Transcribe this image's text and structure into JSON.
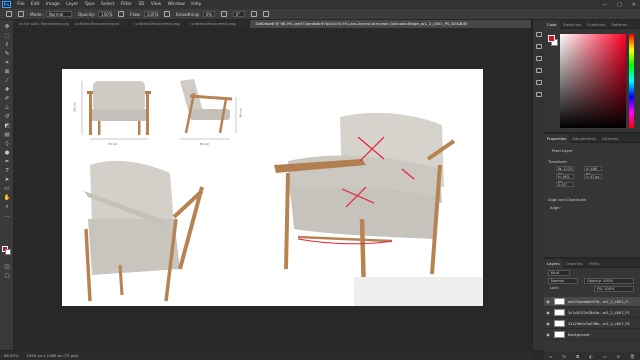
{
  "app": {
    "logo": "Ps",
    "window_controls": [
      "—",
      "□",
      "✕"
    ]
  },
  "menu": [
    "File",
    "Edit",
    "Image",
    "Layer",
    "Type",
    "Select",
    "Filter",
    "3D",
    "View",
    "Window",
    "Help"
  ],
  "options": {
    "mode_label": "Mode:",
    "mode_value": "Normal",
    "opacity_label": "Opacity:",
    "opacity_value": "100%",
    "flow_label": "Flow:",
    "flow_value": "100%",
    "smoothing_label": "Smoothing:",
    "smoothing_value": "0%",
    "angle_value": "0°"
  },
  "tabs": [
    {
      "label": "cs for sofa, Recovered.png"
    },
    {
      "label": "untitled-Recovered.psd"
    },
    {
      "label": "untitled-Recovered.png"
    },
    {
      "label": "untitled-Recovered.png"
    },
    {
      "label": "1b60dbe8 @ 66.9% (ae374aeab8c97b0e2c5c79-Lars-Accent-Armchair-Oakcolor-Beige_ar1_2_LB01_PS_BG&B/8)"
    }
  ],
  "status": {
    "zoom": "66.92%",
    "doc_size": "1920 px x 1080 px (72 ppi)"
  },
  "document": {
    "dims": {
      "front_width": "70 cm",
      "side_depth": "80 cm",
      "front_height": "68 cm",
      "side_height": "68 cm"
    }
  },
  "colors": {
    "foreground": "#c8102e",
    "background": "#ffffff",
    "annotation": "#e8203a"
  },
  "color_panel": {
    "tabs": [
      "Color",
      "Swatches",
      "Gradients",
      "Patterns"
    ]
  },
  "properties": {
    "tabs": [
      "Properties",
      "Adjustments",
      "Libraries"
    ],
    "layer_type": "Pixel Layer",
    "transform_title": "Transform",
    "w": "W: 1235 px",
    "h": "H: 695 px",
    "x": "X: 486 px",
    "y": "Y: 47 px",
    "angle": "0.00°",
    "align_title": "Align and Distribute",
    "align_label": "Align:"
  },
  "layers": {
    "tabs": [
      "Layers",
      "Channels",
      "Paths"
    ],
    "kind": "Kind",
    "blend": "Normal",
    "opacity": "Opacity: 100%",
    "lock": "Lock:",
    "fill": "Fill: 100%",
    "items": [
      {
        "name": "ae374aeab8c97b...ar1_2_LB01_P...",
        "visible": true,
        "active": true
      },
      {
        "name": "3c1c8102e28b3e...ar1_2_LB01_P1",
        "visible": true,
        "active": false
      },
      {
        "name": "31c29b0c5a038e...ar1_2_LB07_PS",
        "visible": true,
        "active": false
      },
      {
        "name": "Background",
        "visible": true,
        "active": false
      }
    ],
    "footer_icons": [
      "link-icon",
      "fx-icon",
      "mask-icon",
      "adjustment-icon",
      "folder-icon",
      "new-layer-icon",
      "trash-icon"
    ]
  }
}
